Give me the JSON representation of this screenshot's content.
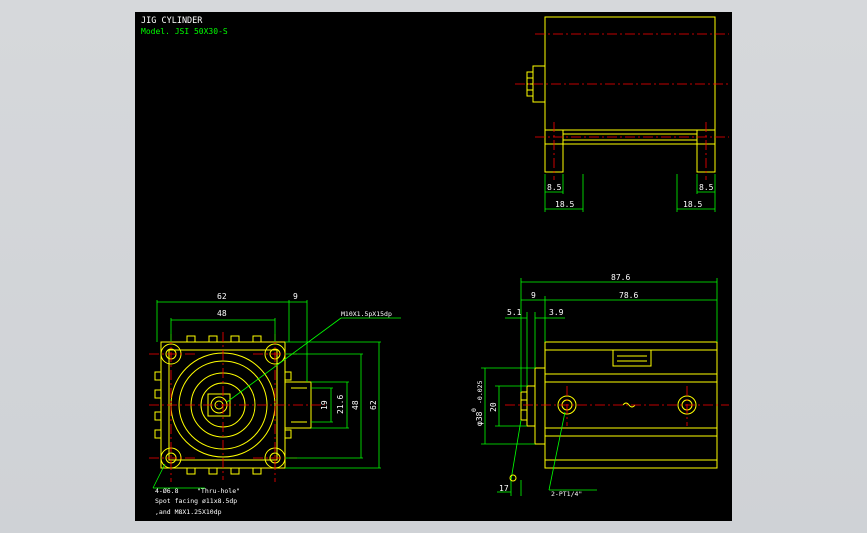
{
  "title": {
    "line1": "JIG CYLINDER",
    "line2": "Model. JSI 50X30-S"
  },
  "dims": {
    "bottom_left_8_5": "8.5",
    "bottom_right_8_5": "8.5",
    "bottom_left_18_5": "18.5",
    "bottom_right_18_5": "18.5",
    "width_62": "62",
    "width_48": "48",
    "right_9": "9",
    "height_19": "19",
    "height_21_6": "21.6",
    "height_48": "48",
    "height_62": "62",
    "len_87_6": "87.6",
    "len_78_6": "78.6",
    "len_9": "9",
    "len_5_1": "5.1",
    "len_3_9": "3.9",
    "dia_38": "φ38",
    "dia_38_tol": "-0.025",
    "dia_38_tol0": "0",
    "h_20": "20",
    "len_17": "17"
  },
  "notes": {
    "thread": "M10X1.5pX15dp",
    "holes": "4-Ø6.8",
    "thru": "\"Thru-hole\"",
    "spot": "Spot facing  ø11x8.5dp",
    "and": ",and M8X1.25X10dp",
    "port": "2-PT1/4\""
  },
  "colors": {
    "background": "#000000",
    "outline": "#ffff00",
    "dimension": "#00ff00",
    "centerline": "#ff0000",
    "text": "#ffffff"
  }
}
